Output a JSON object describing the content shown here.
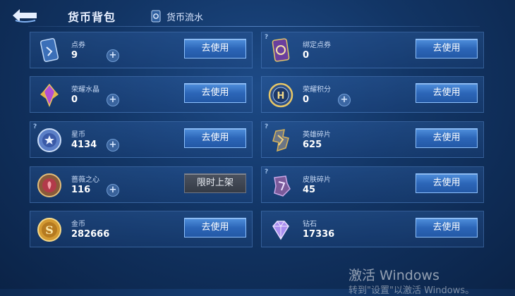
{
  "header": {
    "title": "货币背包",
    "flow_label": "货币流水"
  },
  "currencies": [
    {
      "name": "点券",
      "value": "9",
      "button": "去使用",
      "has_plus": true,
      "has_help": false,
      "icon": "coupon-card-icon"
    },
    {
      "name": "绑定点券",
      "value": "0",
      "button": "去使用",
      "has_plus": false,
      "has_help": true,
      "icon": "bound-coupon-card-icon"
    },
    {
      "name": "荣耀水晶",
      "value": "0",
      "button": "去使用",
      "has_plus": true,
      "has_help": false,
      "icon": "glory-crystal-icon"
    },
    {
      "name": "荣耀积分",
      "value": "0",
      "button": "去使用",
      "has_plus": true,
      "has_help": false,
      "icon": "glory-points-icon"
    },
    {
      "name": "星币",
      "value": "4134",
      "button": "去使用",
      "has_plus": true,
      "has_help": true,
      "icon": "star-coin-icon"
    },
    {
      "name": "英雄碎片",
      "value": "625",
      "button": "去使用",
      "has_plus": false,
      "has_help": true,
      "icon": "hero-fragment-icon"
    },
    {
      "name": "蔷薇之心",
      "value": "116",
      "button": "限时上架",
      "has_plus": true,
      "has_help": false,
      "icon": "rose-heart-icon"
    },
    {
      "name": "皮肤碎片",
      "value": "45",
      "button": "去使用",
      "has_plus": false,
      "has_help": true,
      "icon": "skin-fragment-icon"
    },
    {
      "name": "金币",
      "value": "282666",
      "button": "去使用",
      "has_plus": false,
      "has_help": false,
      "icon": "gold-coin-icon"
    },
    {
      "name": "钻石",
      "value": "17336",
      "button": "去使用",
      "has_plus": false,
      "has_help": false,
      "icon": "diamond-icon"
    }
  ],
  "watermark": {
    "line1": "激活 Windows",
    "line2": "转到\"设置\"以激活 Windows。"
  }
}
